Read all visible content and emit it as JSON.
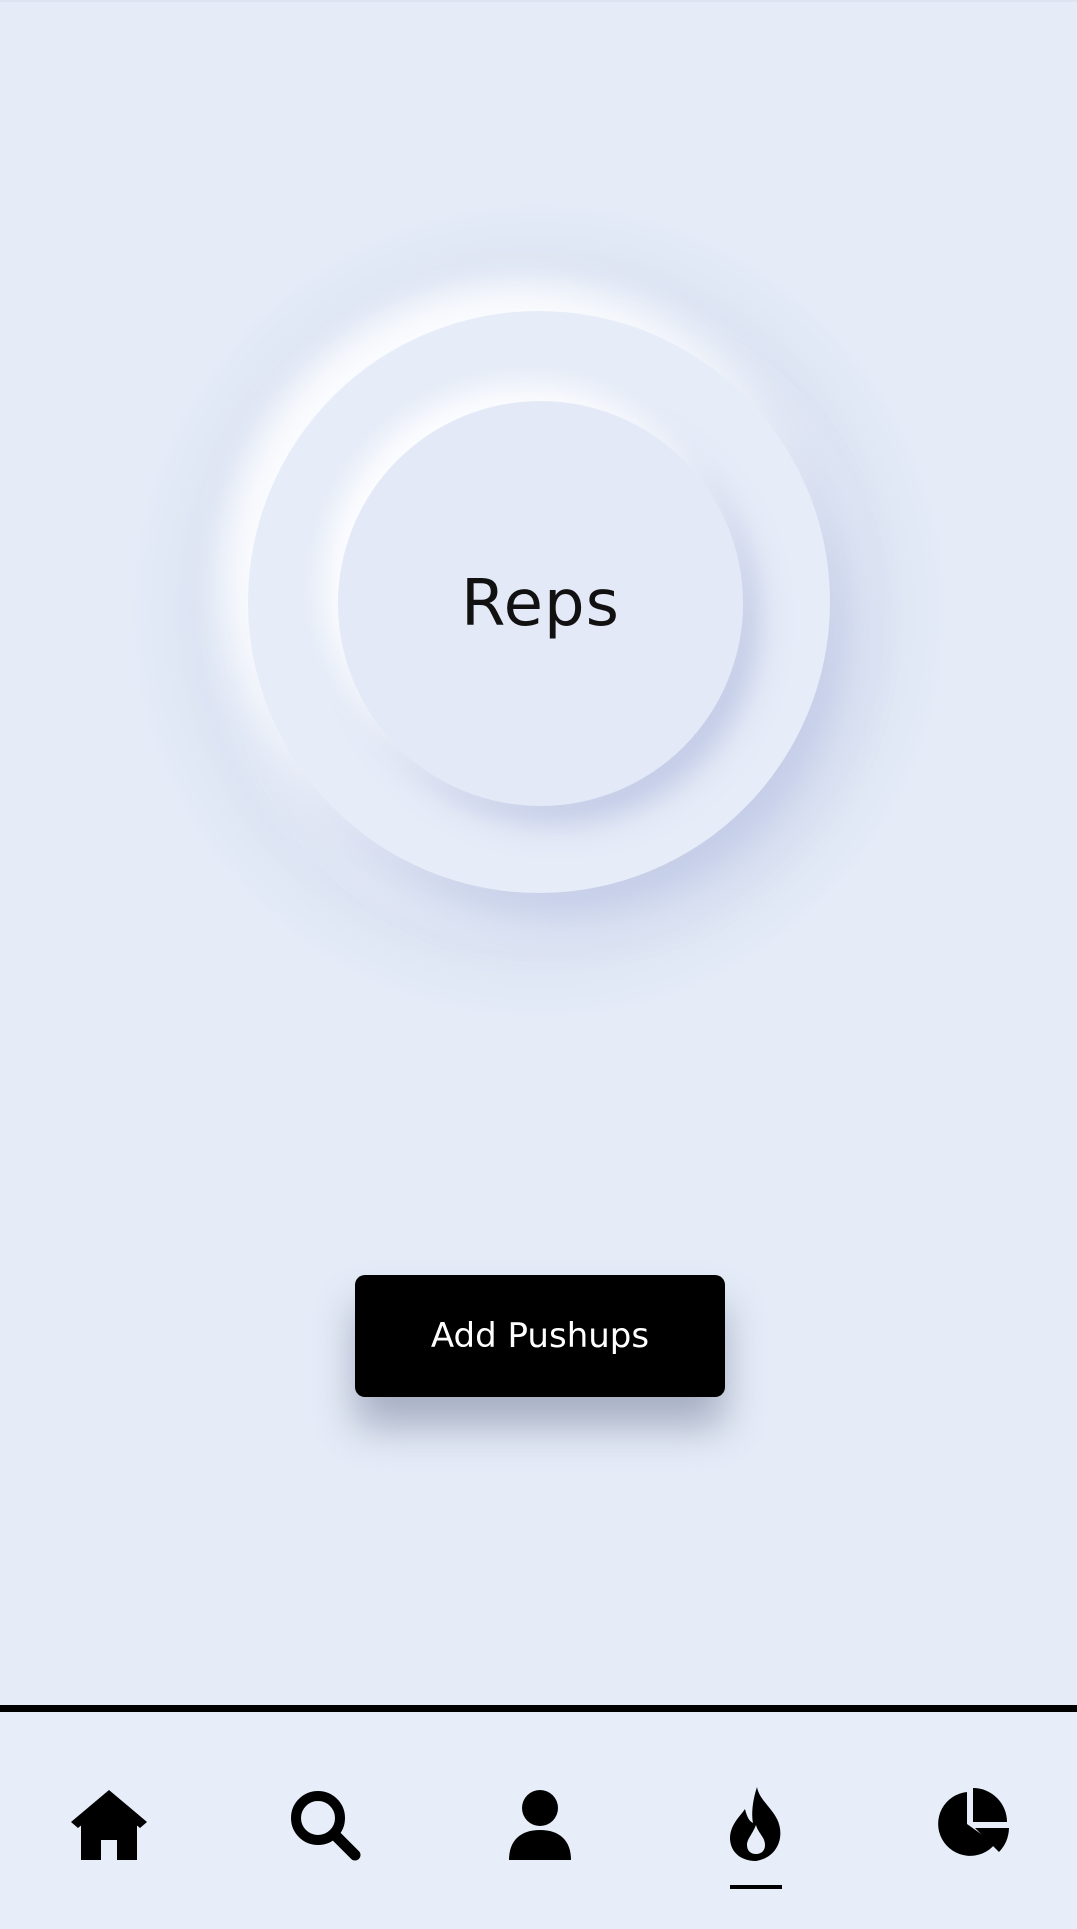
{
  "counter": {
    "label": "Reps"
  },
  "actions": {
    "add_button_label": "Add Pushups"
  },
  "nav": {
    "items": [
      {
        "icon": "home-icon"
      },
      {
        "icon": "search-icon"
      },
      {
        "icon": "user-icon"
      },
      {
        "icon": "flame-icon",
        "active": true
      },
      {
        "icon": "pie-chart-icon"
      }
    ]
  },
  "colors": {
    "background": "#e5ecf8",
    "button": "#000000",
    "button_text": "#ffffff",
    "icon": "#000000"
  }
}
